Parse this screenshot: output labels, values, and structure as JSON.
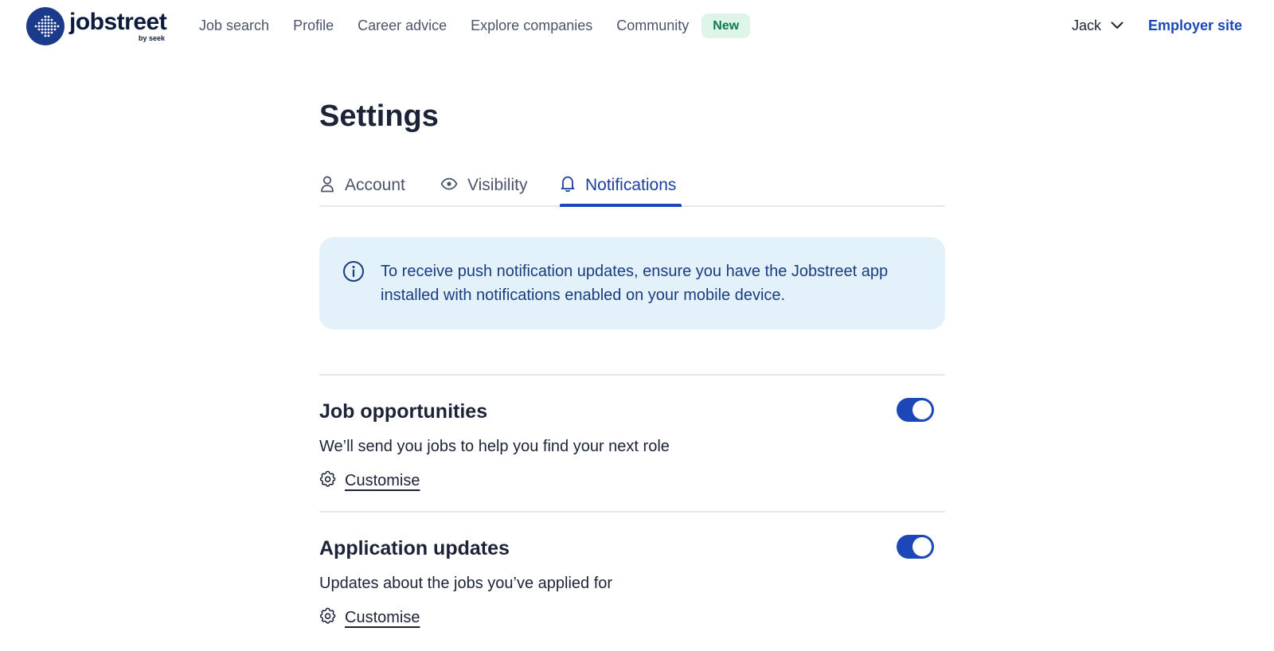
{
  "brand": {
    "name": "jobstreet",
    "sub": "by seek",
    "color": "#1b3a8a"
  },
  "nav": {
    "items": [
      {
        "label": "Job search"
      },
      {
        "label": "Profile"
      },
      {
        "label": "Career advice"
      },
      {
        "label": "Explore companies"
      },
      {
        "label": "Community"
      }
    ],
    "new_badge": "New"
  },
  "user": {
    "name": "Jack",
    "menu_icon": "chevron-down-icon"
  },
  "employer_link": "Employer site",
  "page": {
    "title": "Settings"
  },
  "tabs": [
    {
      "label": "Account",
      "icon": "person-icon",
      "active": false
    },
    {
      "label": "Visibility",
      "icon": "eye-icon",
      "active": false
    },
    {
      "label": "Notifications",
      "icon": "bell-icon",
      "active": true
    }
  ],
  "info": {
    "icon": "info-icon",
    "text": "To receive push notification updates, ensure you have the Jobstreet app installed with notifications enabled on your mobile device."
  },
  "sections": [
    {
      "title": "Job opportunities",
      "description": "We’ll send you jobs to help you find your next role",
      "customise_label": "Customise",
      "enabled": true
    },
    {
      "title": "Application updates",
      "description": "Updates about the jobs you’ve applied for",
      "customise_label": "Customise",
      "enabled": true
    }
  ],
  "colors": {
    "accent": "#1c47b8",
    "info_bg": "#e3f1fa",
    "badge_bg": "#dff5ea",
    "badge_text": "#0c7a4a"
  }
}
